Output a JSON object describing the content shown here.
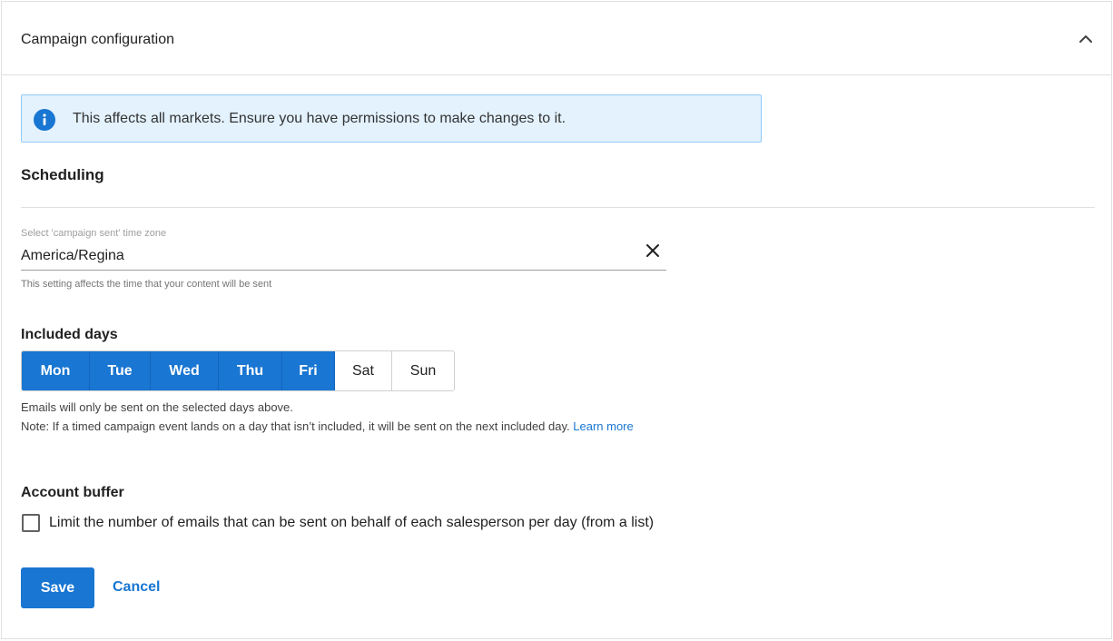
{
  "panel": {
    "title": "Campaign configuration",
    "collapse_icon": "chevron-up-icon"
  },
  "banner": {
    "icon": "info-icon",
    "text": "This affects all markets. Ensure you have permissions to make changes to it.",
    "background_color": "#e3f2fd",
    "icon_color": "#1976d2"
  },
  "scheduling": {
    "title": "Scheduling",
    "timezone": {
      "label": "Select 'campaign sent' time zone",
      "value": "America/Regina",
      "clear_icon": "close-icon",
      "hint": "This setting affects the time that your content will be sent"
    }
  },
  "included_days": {
    "title": "Included days",
    "days": [
      {
        "label": "Mon",
        "selected": true
      },
      {
        "label": "Tue",
        "selected": true
      },
      {
        "label": "Wed",
        "selected": true
      },
      {
        "label": "Thu",
        "selected": true
      },
      {
        "label": "Fri",
        "selected": true
      },
      {
        "label": "Sat",
        "selected": false
      },
      {
        "label": "Sun",
        "selected": false
      }
    ],
    "note_line1": "Emails will only be sent on the selected days above.",
    "note_line2": "Note: If a timed campaign event lands on a day that isn’t included, it will be sent on the next included day.",
    "learn_more": "Learn more",
    "selected_color": "#1976d2"
  },
  "account_buffer": {
    "title": "Account buffer",
    "checkbox_label": "Limit the number of emails that can be sent on behalf of each salesperson per day (from a list)",
    "checked": false
  },
  "actions": {
    "save_label": "Save",
    "cancel_label": "Cancel",
    "primary_color": "#1976d2"
  }
}
